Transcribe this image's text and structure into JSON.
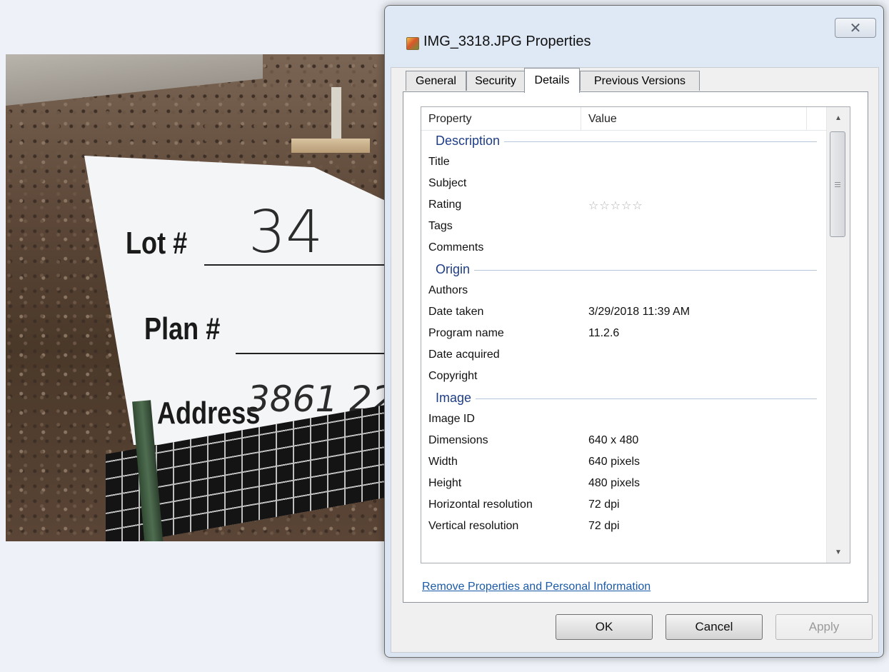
{
  "dialog": {
    "title": "IMG_3318.JPG Properties",
    "close_glyph": "✕"
  },
  "tabs": [
    {
      "label": "General"
    },
    {
      "label": "Security"
    },
    {
      "label": "Details"
    },
    {
      "label": "Previous Versions"
    }
  ],
  "active_tab": "Details",
  "list": {
    "header": {
      "property": "Property",
      "value": "Value"
    },
    "groups": [
      {
        "label": "Description",
        "rows": [
          {
            "property": "Title",
            "value": ""
          },
          {
            "property": "Subject",
            "value": ""
          },
          {
            "property": "Rating",
            "value": "☆☆☆☆☆"
          },
          {
            "property": "Tags",
            "value": ""
          },
          {
            "property": "Comments",
            "value": ""
          }
        ]
      },
      {
        "label": "Origin",
        "rows": [
          {
            "property": "Authors",
            "value": ""
          },
          {
            "property": "Date taken",
            "value": "3/29/2018 11:39 AM"
          },
          {
            "property": "Program name",
            "value": "11.2.6"
          },
          {
            "property": "Date acquired",
            "value": ""
          },
          {
            "property": "Copyright",
            "value": ""
          }
        ]
      },
      {
        "label": "Image",
        "rows": [
          {
            "property": "Image ID",
            "value": ""
          },
          {
            "property": "Dimensions",
            "value": "640 x 480"
          },
          {
            "property": "Width",
            "value": "640 pixels"
          },
          {
            "property": "Height",
            "value": "480 pixels"
          },
          {
            "property": "Horizontal resolution",
            "value": "72 dpi"
          },
          {
            "property": "Vertical resolution",
            "value": "72 dpi"
          }
        ]
      }
    ]
  },
  "remove_link": "Remove Properties and Personal Information",
  "buttons": {
    "ok": "OK",
    "cancel": "Cancel",
    "apply": "Apply"
  },
  "photo": {
    "sign_labels": {
      "lot": "Lot #",
      "plan": "Plan #",
      "address": "Address"
    },
    "handwritten": {
      "lot": "34",
      "address": "3861 22"
    }
  }
}
